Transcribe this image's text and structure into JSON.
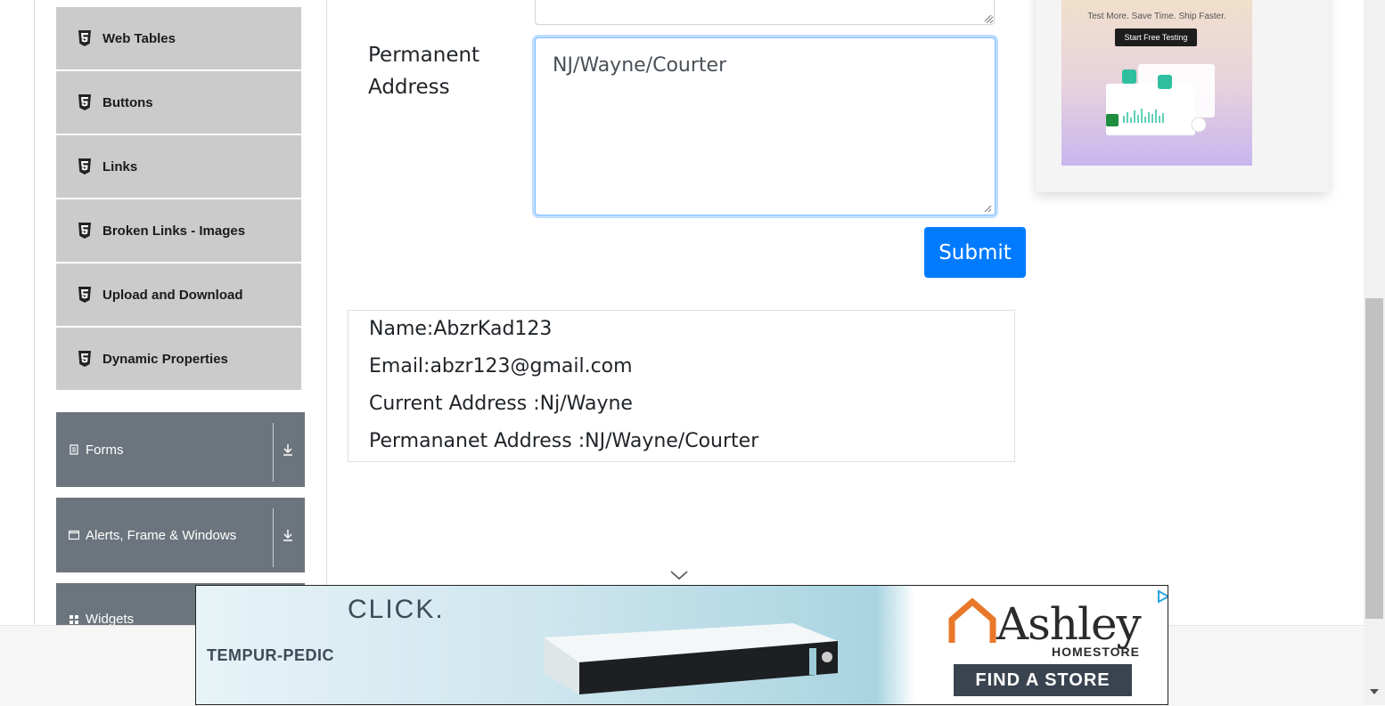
{
  "sidebar": {
    "elements": [
      {
        "label": "Web Tables"
      },
      {
        "label": "Buttons"
      },
      {
        "label": "Links"
      },
      {
        "label": "Broken Links - Images"
      },
      {
        "label": "Upload and Download"
      },
      {
        "label": "Dynamic Properties"
      }
    ],
    "groups": [
      {
        "label": "Forms"
      },
      {
        "label": "Alerts, Frame & Windows"
      },
      {
        "label": "Widgets"
      }
    ]
  },
  "form": {
    "permanent_address_label_line1": "Permanent",
    "permanent_address_label_line2": "Address",
    "permanent_address_value": "NJ/Wayne/Courter",
    "submit_label": "Submit"
  },
  "output": {
    "name": "Name:AbzrKad123",
    "email": "Email:abzr123@gmail.com",
    "current_address": "Current Address :Nj/Wayne",
    "permanent_address": "Permananet Address :NJ/Wayne/Courter"
  },
  "side_ad": {
    "tagline": "Test More. Save Time. Ship Faster.",
    "button": "Start Free Testing"
  },
  "bottom_ad": {
    "headline": "CLICK.",
    "brand_left": "TEMPUR-PEDIC",
    "brand_right": "Ashley",
    "brand_right_sub": "HOMESTORE",
    "cta": "FIND A STORE"
  },
  "colors": {
    "sidebar_item_bg": "#cbcbcb",
    "group_bg": "#6c757d",
    "submit_bg": "#007bff",
    "focus_border": "#80bdff"
  }
}
